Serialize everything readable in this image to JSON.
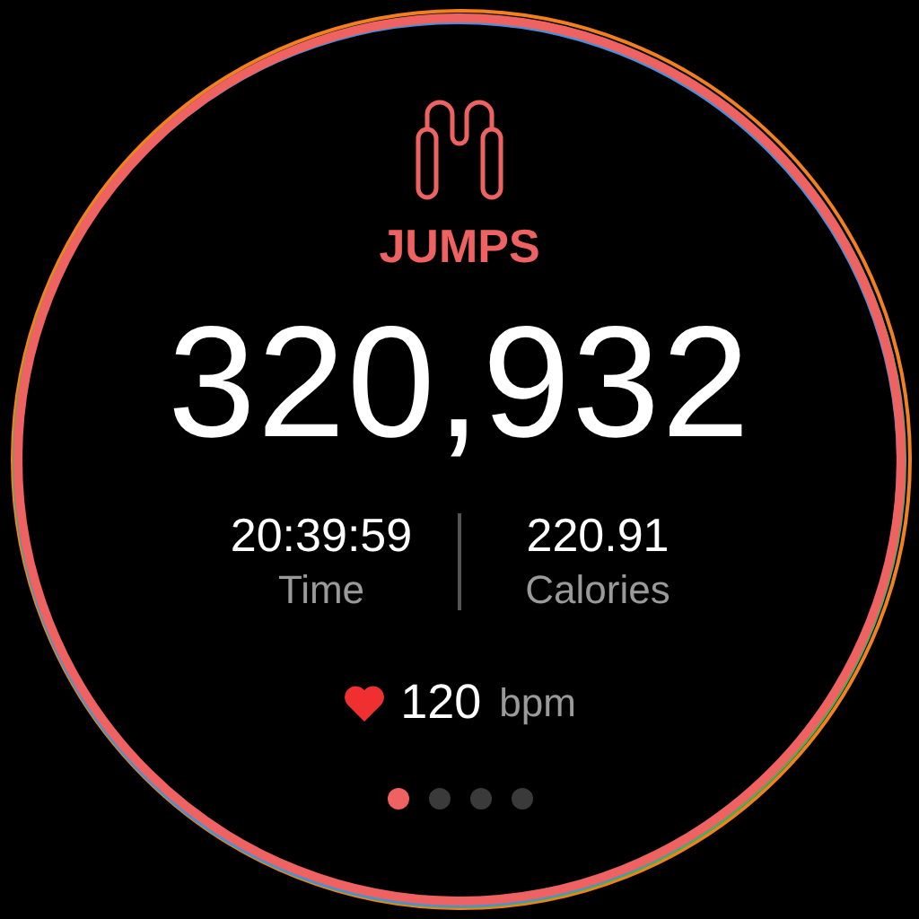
{
  "workout": {
    "title": "JUMPS",
    "count": "320,932"
  },
  "stats": [
    {
      "value": "20:39:59",
      "label": "Time"
    },
    {
      "value": "220.91",
      "label": "Calories"
    }
  ],
  "heart_rate": {
    "value": "120",
    "unit": "bpm"
  },
  "pages": [
    {
      "selected": true
    },
    {
      "selected": false
    },
    {
      "selected": false
    },
    {
      "selected": false
    }
  ]
}
